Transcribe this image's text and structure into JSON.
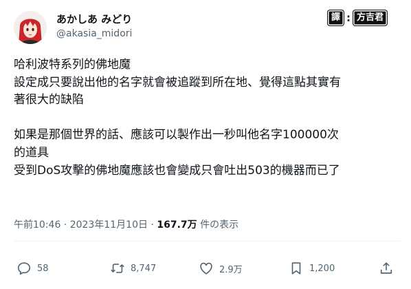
{
  "user": {
    "display_name": "あかしあ みどり",
    "handle": "@akasia_midori"
  },
  "translator_badge": {
    "left": "譯",
    "separator": ":",
    "right": "方吉君"
  },
  "tweet": {
    "lines": [
      "哈利波特系列的佛地魔",
      "設定成只要說出他的名字就會被追蹤到所在地、覺得這點其實有",
      "著很大的缺陷",
      "",
      "如果是那個世界的話、應該可以製作出一秒叫他名字100000次",
      "的道具",
      "受到DoS攻擊的佛地魔應該也會變成只會吐出503的機器而已了"
    ]
  },
  "meta": {
    "time": "午前10:46",
    "sep1": " · ",
    "date": "2023年11月10日",
    "sep2": " · ",
    "views": "167.7万",
    "views_suffix": " 件の表示"
  },
  "actions": {
    "reply_count": "58",
    "retweet_count": "8,747",
    "like_count": "2.9万",
    "bookmark_count": "1,200"
  },
  "icons": {
    "reply": "reply-icon",
    "retweet": "retweet-icon",
    "like": "heart-icon",
    "bookmark": "bookmark-icon",
    "share": "share-icon"
  },
  "colors": {
    "text": "#0f1419",
    "secondary": "#536471",
    "divider": "#eff3f4"
  }
}
